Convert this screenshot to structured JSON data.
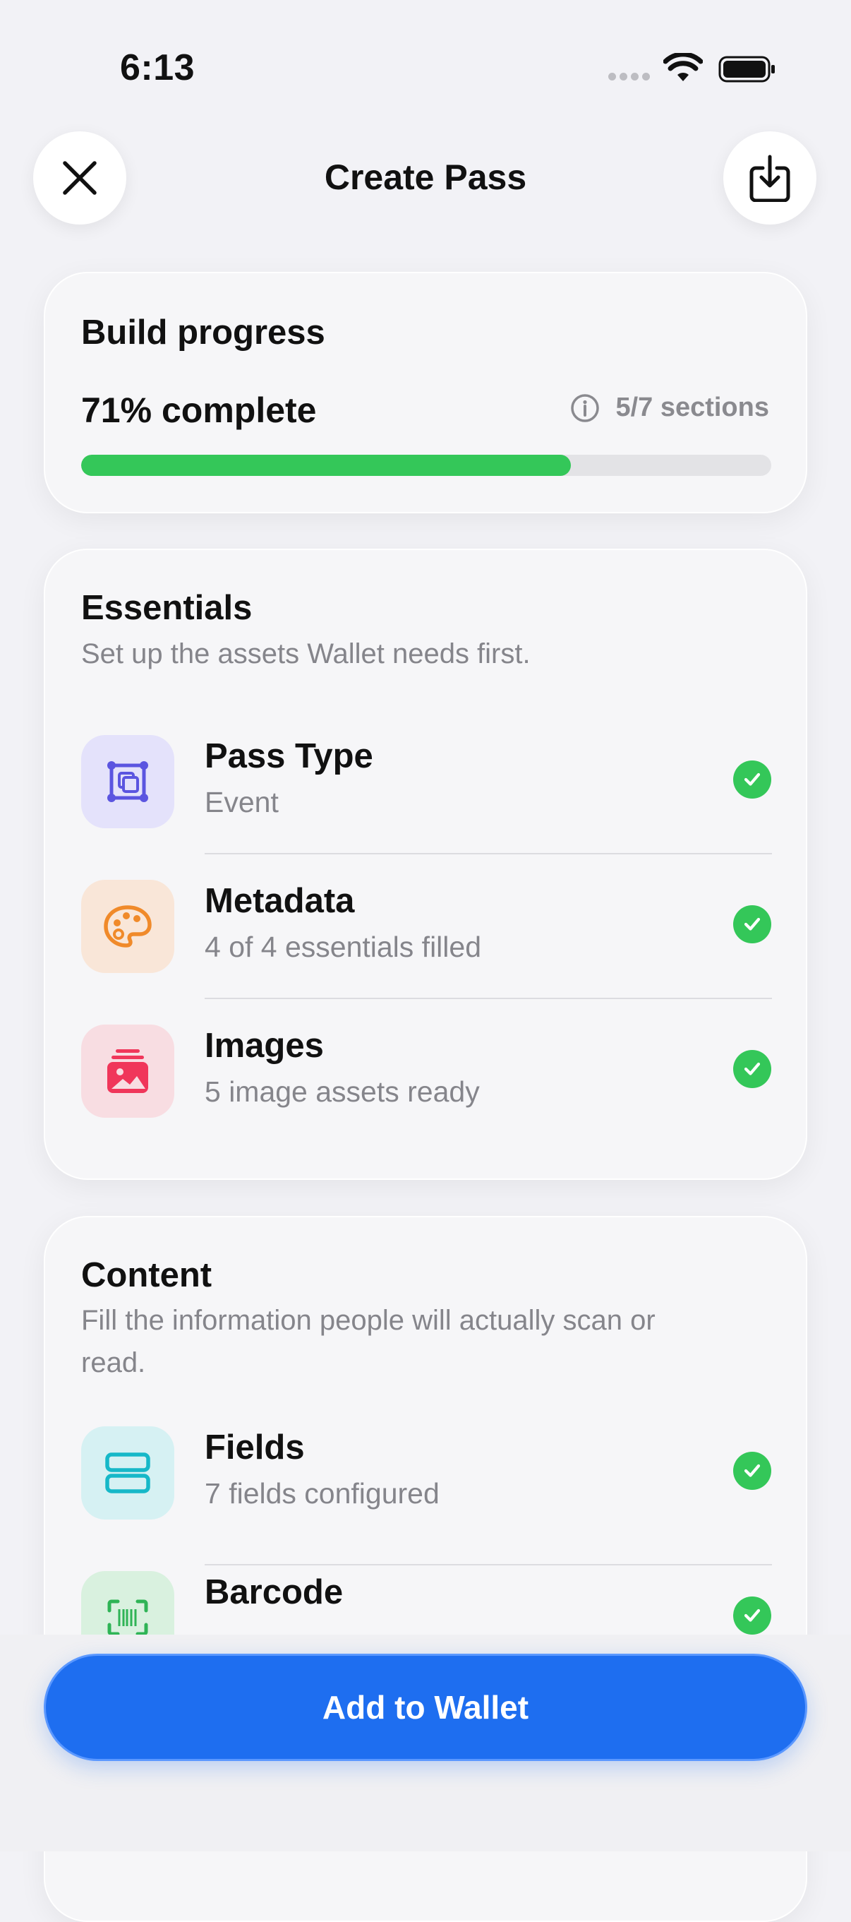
{
  "status_bar": {
    "time": "6:13"
  },
  "nav": {
    "title": "Create Pass"
  },
  "progress": {
    "title": "Build progress",
    "percent_label": "71% complete",
    "sections_label": "5/7 sections",
    "fraction": 0.71,
    "bar_color": "#34c759"
  },
  "essentials": {
    "title": "Essentials",
    "subtitle": "Set up the assets Wallet needs first.",
    "rows": [
      {
        "title": "Pass Type",
        "subtitle": "Event",
        "icon": "pass-type-icon",
        "icon_bg": "#e4e2fb",
        "icon_color": "#5b55e0",
        "done": true
      },
      {
        "title": "Metadata",
        "subtitle": "4 of 4 essentials filled",
        "icon": "palette-icon",
        "icon_bg": "#f9e6d8",
        "icon_color": "#f08a2a",
        "done": true
      },
      {
        "title": "Images",
        "subtitle": "5 image assets ready",
        "icon": "photo-stack-icon",
        "icon_bg": "#f8dde2",
        "icon_color": "#f0365a",
        "done": true
      }
    ]
  },
  "content": {
    "title": "Content",
    "subtitle": "Fill the information people will actually scan or read.",
    "rows": [
      {
        "title": "Fields",
        "subtitle": "7 fields configured",
        "icon": "fields-icon",
        "icon_bg": "#d6f1f3",
        "icon_color": "#16b8c8",
        "done": true
      },
      {
        "title": "Barcode",
        "subtitle": "",
        "icon": "barcode-icon",
        "icon_bg": "#d9f1df",
        "icon_color": "#2fb456",
        "done": true
      }
    ]
  },
  "cta": {
    "label": "Add to Wallet",
    "color": "#1e6ef0"
  }
}
